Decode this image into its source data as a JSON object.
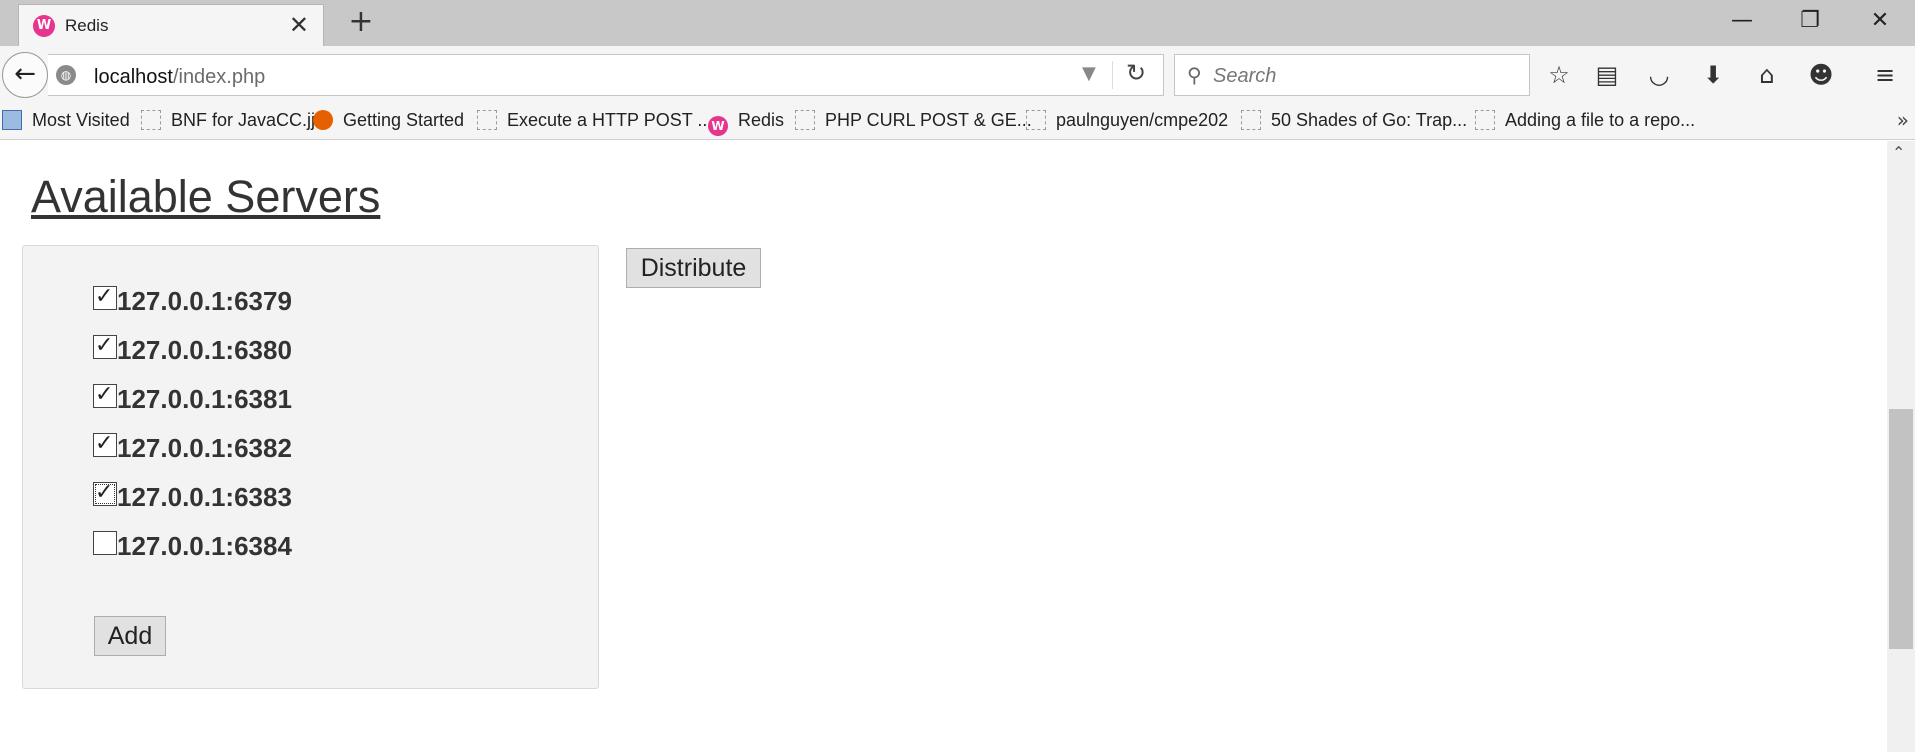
{
  "browser": {
    "tab": {
      "title": "Redis",
      "favicon": "W"
    },
    "url": {
      "host": "localhost",
      "path": "/index.php"
    },
    "search": {
      "placeholder": "Search"
    }
  },
  "bookmarks": [
    {
      "label": "Most Visited",
      "icon": "mv"
    },
    {
      "label": "BNF for JavaCC.jj",
      "icon": "page"
    },
    {
      "label": "Getting Started",
      "icon": "ff"
    },
    {
      "label": "Execute a HTTP POST ...",
      "icon": "page"
    },
    {
      "label": "Redis",
      "icon": "redis"
    },
    {
      "label": "PHP CURL POST & GE...",
      "icon": "page"
    },
    {
      "label": "paulnguyen/cmpe202",
      "icon": "page"
    },
    {
      "label": "50 Shades of Go: Trap...",
      "icon": "page"
    },
    {
      "label": "Adding a file to a repo...",
      "icon": "page"
    }
  ],
  "page": {
    "heading": "Available Servers",
    "servers": [
      {
        "label": "127.0.0.1:6379",
        "checked": true
      },
      {
        "label": "127.0.0.1:6380",
        "checked": true
      },
      {
        "label": "127.0.0.1:6381",
        "checked": true
      },
      {
        "label": "127.0.0.1:6382",
        "checked": true
      },
      {
        "label": "127.0.0.1:6383",
        "checked": true
      },
      {
        "label": "127.0.0.1:6384",
        "checked": false
      }
    ],
    "add_label": "Add",
    "distribute_label": "Distribute"
  }
}
